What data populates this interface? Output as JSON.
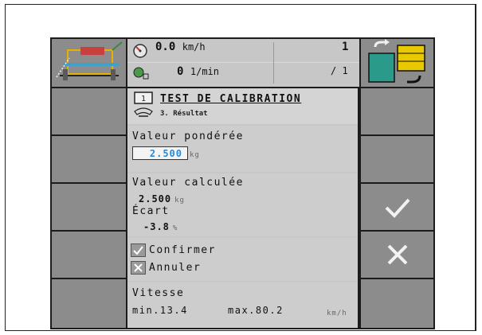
{
  "status": {
    "speed_value": "0.0",
    "speed_unit": "km/h",
    "rpm_value": "0",
    "rpm_unit": "1/min",
    "counter_top": "1",
    "counter_bottom": "/ 1"
  },
  "header": {
    "title": "TEST DE CALIBRATION",
    "subtitle": "3. Résultat"
  },
  "weighted": {
    "label": "Valeur pondérée",
    "value": "2.500",
    "unit": "kg"
  },
  "calculated": {
    "label": "Valeur calculée",
    "value": "2.500",
    "unit": "kg"
  },
  "deviation": {
    "label": "Écart",
    "value": "-3.8",
    "unit": "%"
  },
  "actions": {
    "confirm": "Confirmer",
    "cancel": "Annuler"
  },
  "speed_range": {
    "label": "Vitesse",
    "min_text": "min.13.4",
    "max_text": "max.80.2",
    "unit": "km/h"
  },
  "colors": {
    "softkey": "#8c8c8c",
    "panel": "#c7c7c7",
    "input_text": "#2a8ad8",
    "background": "#1c1c1c"
  },
  "icons": {
    "softkey_right_4": "checkmark-icon",
    "softkey_right_5": "cross-icon"
  }
}
